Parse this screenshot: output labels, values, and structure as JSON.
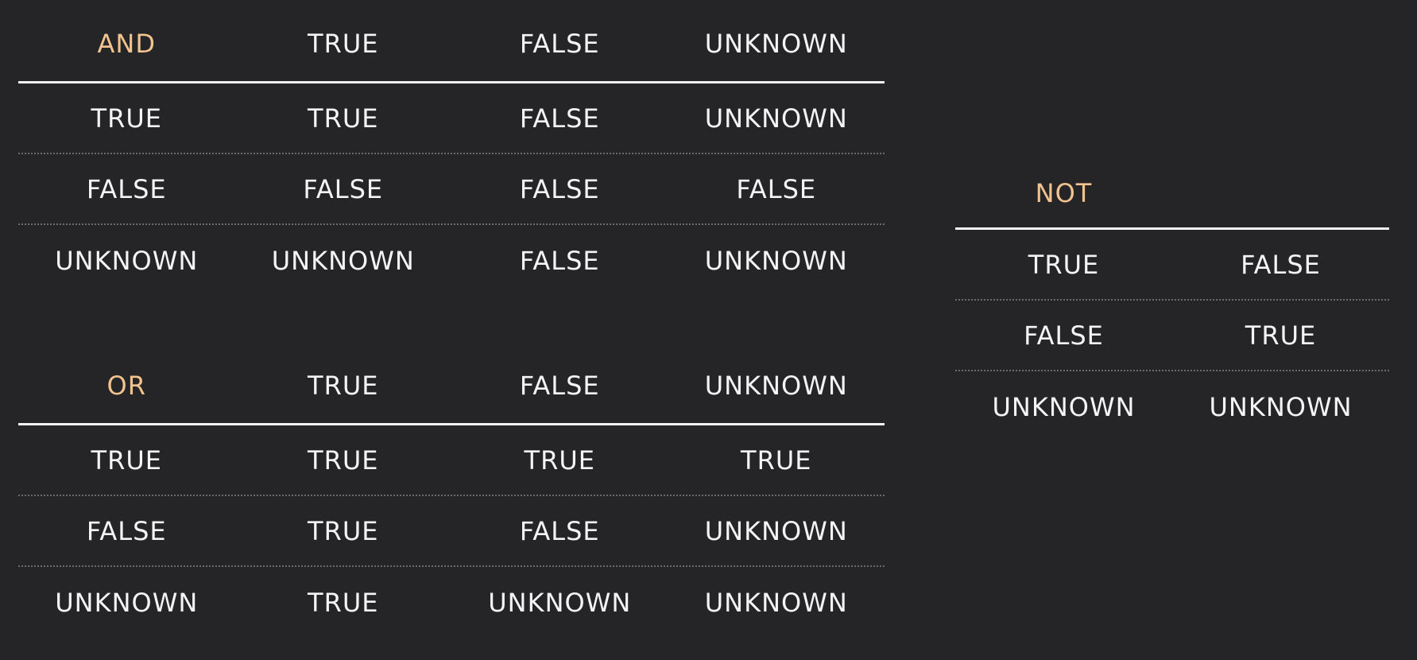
{
  "and_table": {
    "operator": "AND",
    "columns": [
      "TRUE",
      "FALSE",
      "UNKNOWN"
    ],
    "rows": [
      {
        "label": "TRUE",
        "values": [
          "TRUE",
          "FALSE",
          "UNKNOWN"
        ]
      },
      {
        "label": "FALSE",
        "values": [
          "FALSE",
          "FALSE",
          "FALSE"
        ]
      },
      {
        "label": "UNKNOWN",
        "values": [
          "UNKNOWN",
          "FALSE",
          "UNKNOWN"
        ]
      }
    ]
  },
  "or_table": {
    "operator": "OR",
    "columns": [
      "TRUE",
      "FALSE",
      "UNKNOWN"
    ],
    "rows": [
      {
        "label": "TRUE",
        "values": [
          "TRUE",
          "TRUE",
          "TRUE"
        ]
      },
      {
        "label": "FALSE",
        "values": [
          "TRUE",
          "FALSE",
          "UNKNOWN"
        ]
      },
      {
        "label": "UNKNOWN",
        "values": [
          "TRUE",
          "UNKNOWN",
          "UNKNOWN"
        ]
      }
    ]
  },
  "not_table": {
    "operator": "NOT",
    "rows": [
      {
        "label": "TRUE",
        "value": "FALSE"
      },
      {
        "label": "FALSE",
        "value": "TRUE"
      },
      {
        "label": "UNKNOWN",
        "value": "UNKNOWN"
      }
    ]
  },
  "colors": {
    "background": "#252427",
    "text": "#f4f4f4",
    "operator": "#f0c38f",
    "header_rule": "#f2f2f2",
    "row_divider": "#6b6b6e"
  }
}
